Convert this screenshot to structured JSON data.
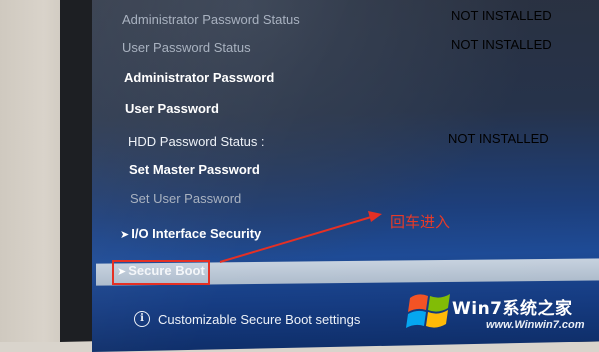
{
  "security_menu": {
    "items": [
      {
        "label": "Administrator Password Status",
        "value": "NOT INSTALLED"
      },
      {
        "label": "User Password Status",
        "value": "NOT INSTALLED"
      },
      {
        "label": "Administrator Password"
      },
      {
        "label": "User Password"
      },
      {
        "label": "HDD Password Status :",
        "value": "NOT INSTALLED"
      },
      {
        "label": "Set Master Password"
      },
      {
        "label": "Set User Password"
      },
      {
        "label": "I/O Interface Security"
      }
    ],
    "selected_item": {
      "label": "Secure Boot"
    }
  },
  "annotation": {
    "text": "回车进入",
    "color": "#e63a28"
  },
  "help_line": {
    "icon": "info-icon",
    "text": "Customizable Secure Boot settings"
  },
  "watermark": {
    "brand": "Win7系统之家",
    "url": "www.Winwin7.com"
  },
  "colors": {
    "screen_top": "#2a3140",
    "screen_bottom": "#1e4b96",
    "highlight": "#c7d2df",
    "annotation_red": "#e53024"
  }
}
